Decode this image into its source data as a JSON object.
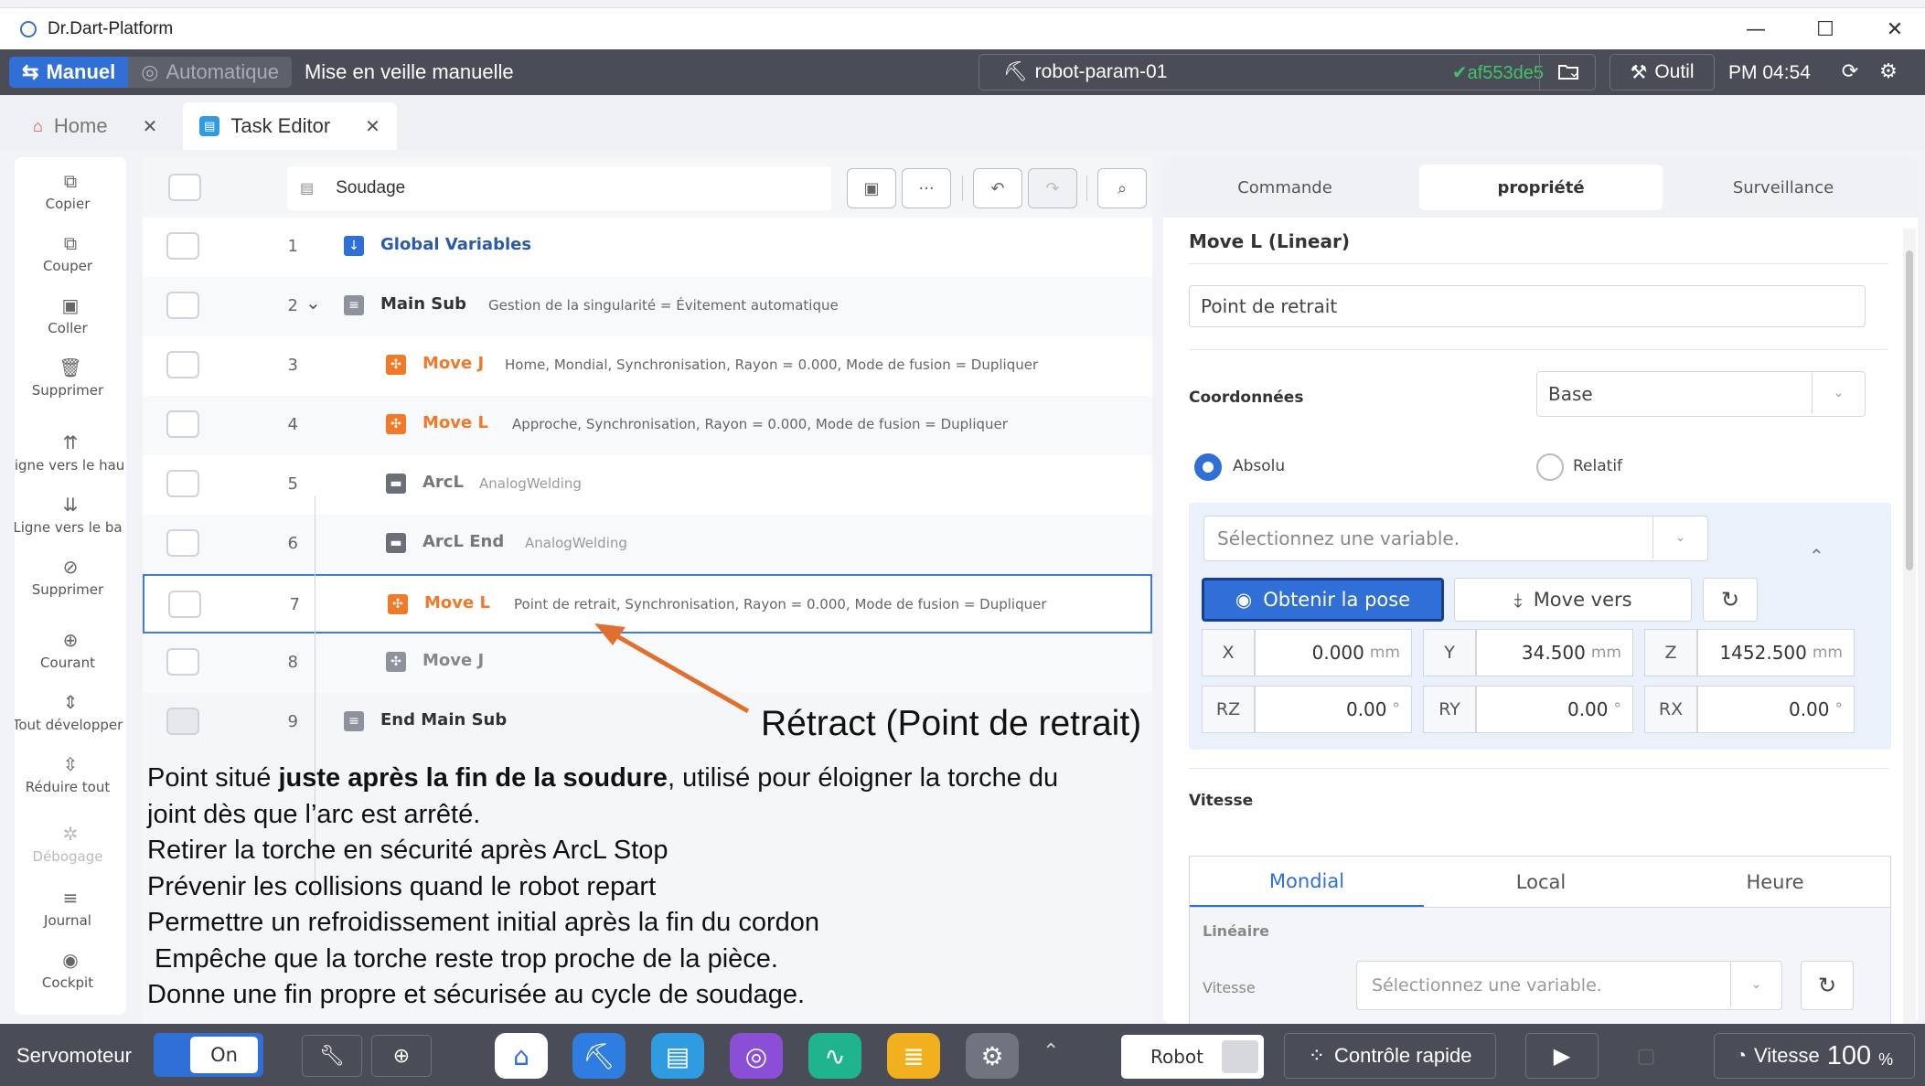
{
  "window": {
    "title": "Dr.Dart-Platform",
    "minimize": "—",
    "maximize": "☐",
    "close": "✕"
  },
  "topbar": {
    "mode_manual": "Manuel",
    "mode_auto": "Automatique",
    "standby": "Mise en veille manuelle",
    "robot_name": "robot-param-01",
    "robot_hash": "af553de5",
    "tool": "Outil",
    "time": "PM 04:54"
  },
  "tabs": [
    {
      "label": "Home",
      "close": "✕"
    },
    {
      "label": "Task Editor",
      "close": "✕"
    }
  ],
  "left_tools": [
    {
      "icon": "copy-icon",
      "glyph": "⧉",
      "label": "Copier"
    },
    {
      "icon": "cut-icon",
      "glyph": "⧉",
      "label": "Couper"
    },
    {
      "icon": "paste-icon",
      "glyph": "▣",
      "label": "Coller"
    },
    {
      "icon": "trash-icon",
      "glyph": "🗑",
      "label": "Supprimer"
    },
    {
      "icon": "line-up-icon",
      "glyph": "⇈",
      "label": "ligne vers le hau"
    },
    {
      "icon": "line-down-icon",
      "glyph": "⇊",
      "label": "Ligne vers le ba"
    },
    {
      "icon": "disable-icon",
      "glyph": "⊘",
      "label": "Supprimer"
    },
    {
      "icon": "current-icon",
      "glyph": "⊕",
      "label": "Courant"
    },
    {
      "icon": "expand-all-icon",
      "glyph": "⇕",
      "label": "Tout développer"
    },
    {
      "icon": "collapse-all-icon",
      "glyph": "⇳",
      "label": "Réduire tout"
    },
    {
      "icon": "debug-icon",
      "glyph": "✲",
      "label": "Débogage"
    },
    {
      "icon": "log-icon",
      "glyph": "≡",
      "label": "Journal"
    },
    {
      "icon": "cockpit-icon",
      "glyph": "◉",
      "label": "Cockpit"
    }
  ],
  "task": {
    "name": "Soudage",
    "rows": [
      {
        "num": "1",
        "name": "Global Variables",
        "desc": "",
        "kind": "global"
      },
      {
        "num": "2",
        "name": "Main Sub",
        "desc": "Gestion de la singularité = Évitement automatique",
        "kind": "sub"
      },
      {
        "num": "3",
        "name": "Move J",
        "desc": "Home, Mondial, Synchronisation, Rayon = 0.000, Mode de fusion = Dupliquer",
        "kind": "move"
      },
      {
        "num": "4",
        "name": "Move L",
        "desc": "Approche, Synchronisation, Rayon = 0.000, Mode de fusion = Dupliquer",
        "kind": "move"
      },
      {
        "num": "5",
        "name": "ArcL",
        "desc": "AnalogWelding",
        "kind": "arc"
      },
      {
        "num": "6",
        "name": "ArcL End",
        "desc": "AnalogWelding",
        "kind": "arc"
      },
      {
        "num": "7",
        "name": "Move L",
        "desc": "Point de retrait, Synchronisation, Rayon = 0.000, Mode de fusion = Dupliquer",
        "kind": "move"
      },
      {
        "num": "8",
        "name": "Move J",
        "desc": "",
        "kind": "movedim"
      },
      {
        "num": "9",
        "name": "End Main Sub",
        "desc": "",
        "kind": "sub"
      }
    ]
  },
  "annotation": {
    "label": "Rétract (Point de retrait)",
    "line1_prefix": "Point situé ",
    "line1_bold": "juste après la fin de la soudure",
    "line1_suffix": ", utilisé pour éloigner la torche du",
    "line2": "joint dès que l’arc est arrêté.",
    "line3": "Retirer la torche en sécurité après ArcL Stop",
    "line4": "Prévenir les collisions quand le robot repart",
    "line5": "Permettre un refroidissement initial après la fin du cordon",
    "line6": " Empêche que la torche reste trop proche de la pièce.",
    "line7": "Donne une fin propre et sécurisée au cycle de soudage.",
    "arrow_color": "#e07030"
  },
  "right": {
    "tabs": [
      "Commande",
      "propriété",
      "Surveillance"
    ],
    "title": "Move L (Linear)",
    "point_name": "Point de retrait",
    "coord_label": "Coordonnées",
    "coord_value": "Base",
    "absolu": "Absolu",
    "relatif": "Relatif",
    "var_placeholder": "Sélectionnez une variable.",
    "btn_pose": "Obtenir la pose",
    "btn_move": "Move vers",
    "coords": [
      {
        "label": "X",
        "value": "0.000",
        "unit": "mm"
      },
      {
        "label": "Y",
        "value": "34.500",
        "unit": "mm"
      },
      {
        "label": "Z",
        "value": "1452.500",
        "unit": "mm"
      },
      {
        "label": "RZ",
        "value": "0.00",
        "unit": "°"
      },
      {
        "label": "RY",
        "value": "0.00",
        "unit": "°"
      },
      {
        "label": "RX",
        "value": "0.00",
        "unit": "°"
      }
    ],
    "vitesse": "Vitesse",
    "speed_tabs": [
      "Mondial",
      "Local",
      "Heure"
    ],
    "lineaire": "Linéaire",
    "vitesse_field": "Vitesse",
    "vitesse_placeholder": "Sélectionnez une variable."
  },
  "bottom": {
    "servo": "Servomoteur",
    "servo_state": "On",
    "robot": "Robot",
    "quick": "Contrôle rapide",
    "speed_label": "Vitesse",
    "speed_value": "100",
    "speed_unit": "%"
  },
  "colors": {
    "accent": "#2f6fd6",
    "topbar": "#4a4d57",
    "move_icon": "#f07a2a",
    "global_icon": "#2f6fd6",
    "hash_green": "#42c26b"
  }
}
